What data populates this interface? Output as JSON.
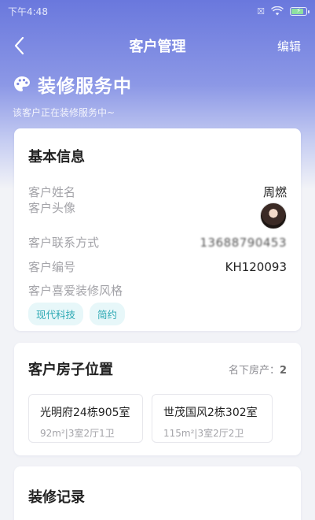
{
  "status_bar": {
    "time": "下午4:48",
    "battery_charging": true
  },
  "nav": {
    "title": "客户管理",
    "edit": "编辑"
  },
  "hero": {
    "title": "装修服务中",
    "subtitle": "该客户正在装修服务中~"
  },
  "basic": {
    "title": "基本信息",
    "name_label": "客户姓名",
    "name_value": "周燃",
    "avatar_label": "客户头像",
    "phone_label": "客户联系方式",
    "phone_value": "13688790453",
    "id_label": "客户编号",
    "id_value": "KH120093",
    "style_label": "客户喜爱装修风格",
    "tags": [
      "现代科技",
      "简约"
    ]
  },
  "houses": {
    "title": "客户房子位置",
    "count_label": "名下房产：",
    "count_value": "2",
    "items": [
      {
        "name": "光明府24栋905室",
        "detail": "92m²|3室2厅1卫"
      },
      {
        "name": "世茂国风2栋302室",
        "detail": "115m²|3室2厅2卫"
      }
    ]
  },
  "records": {
    "title": "装修记录"
  },
  "colors": {
    "accent": "#6a78dd",
    "tag_bg": "#e7f7f9",
    "tag_text": "#2da9b4"
  }
}
